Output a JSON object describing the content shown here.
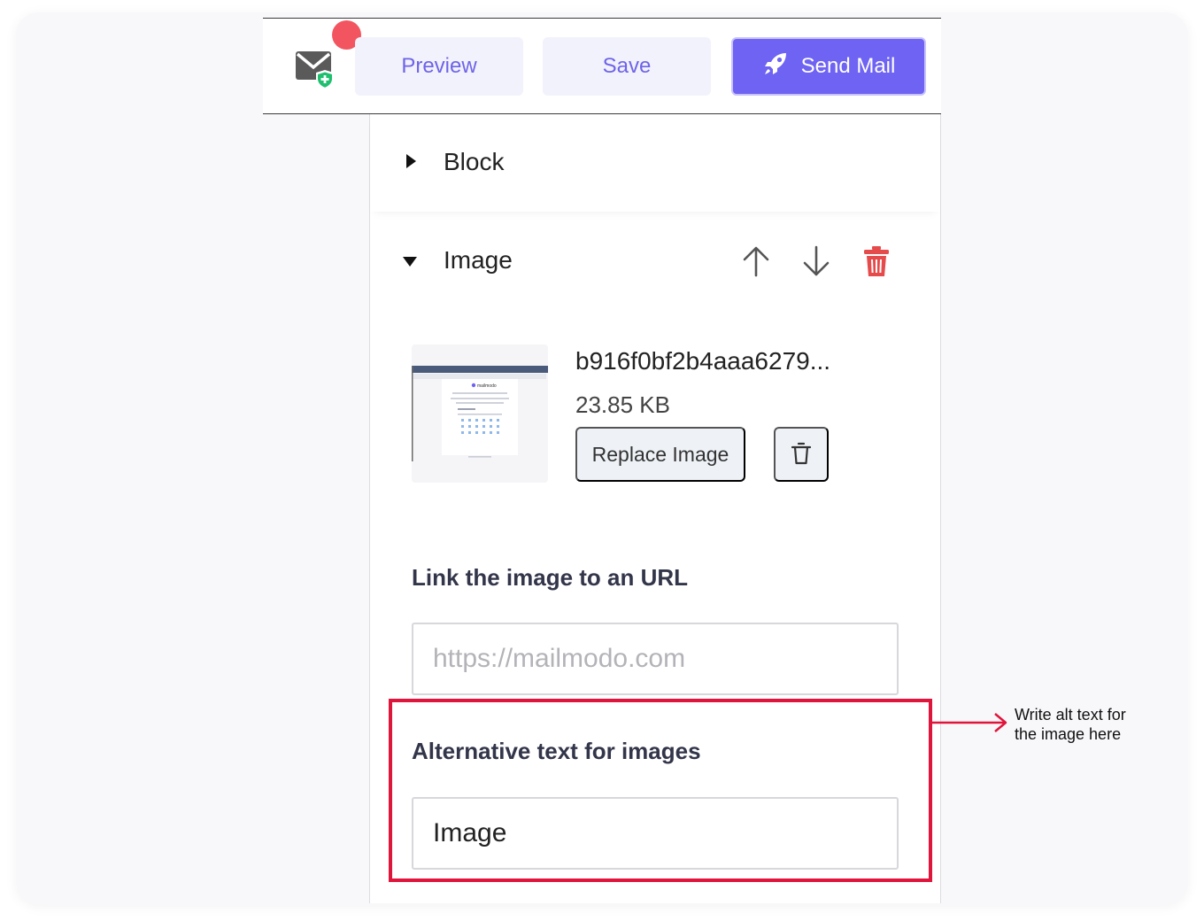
{
  "toolbar": {
    "preview_label": "Preview",
    "save_label": "Save",
    "send_label": "Send Mail"
  },
  "panel": {
    "block_title": "Block",
    "image_title": "Image",
    "file_name": "b916f0bf2b4aaa6279...",
    "file_size": "23.85 KB",
    "replace_label": "Replace Image",
    "link_label": "Link the image to an URL",
    "link_placeholder": "https://mailmodo.com",
    "alt_label": "Alternative text for images",
    "alt_value": "Image"
  },
  "annotation": {
    "line1": "Write alt text for",
    "line2": "the image here"
  },
  "thumbnail": {
    "brand": "mailmodo"
  },
  "colors": {
    "accent": "#6e63f2",
    "accent_soft": "#f2f2fc",
    "danger": "#e54b4b",
    "highlight": "#e0153b",
    "notification": "#f25560",
    "shield": "#1fbf6f"
  }
}
